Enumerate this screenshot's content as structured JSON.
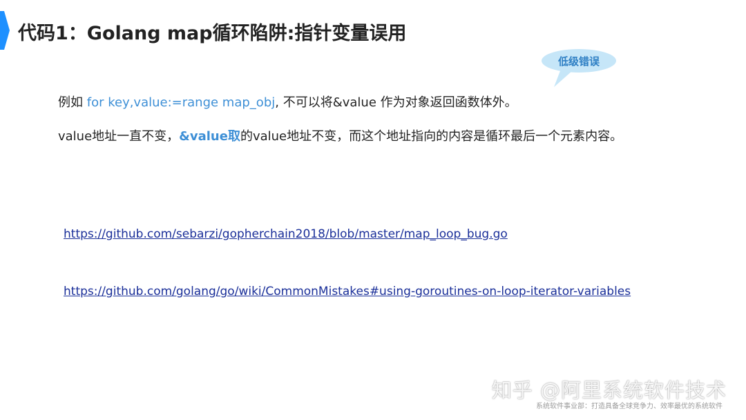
{
  "slide": {
    "title": "代码1：Golang map循环陷阱:指针变量误用",
    "accent_color": "#1e90ff",
    "bubble": {
      "label": "低级错误",
      "fill_color": "#c6e6f8"
    },
    "paragraph1": {
      "prefix": "例如 ",
      "code": "for key,value:=range map_obj",
      "suffix": ", 不可以将&value 作为对象返回函数体外。"
    },
    "paragraph2": {
      "prefix": "value地址一直不变，",
      "emphasis": "&value取",
      "suffix": "的value地址不变，而这个地址指向的内容是循环最后一个元素内容。"
    },
    "links": [
      "https://github.com/sebarzi/gopherchain2018/blob/master/map_loop_bug.go",
      "https://github.com/golang/go/wiki/CommonMistakes#using-goroutines-on-loop-iterator-variables"
    ],
    "watermark": {
      "main": "知乎 @阿里系统软件技术",
      "sub": "系统软件事业部：打造具备全球竞争力、效率最优的系统软件"
    }
  }
}
